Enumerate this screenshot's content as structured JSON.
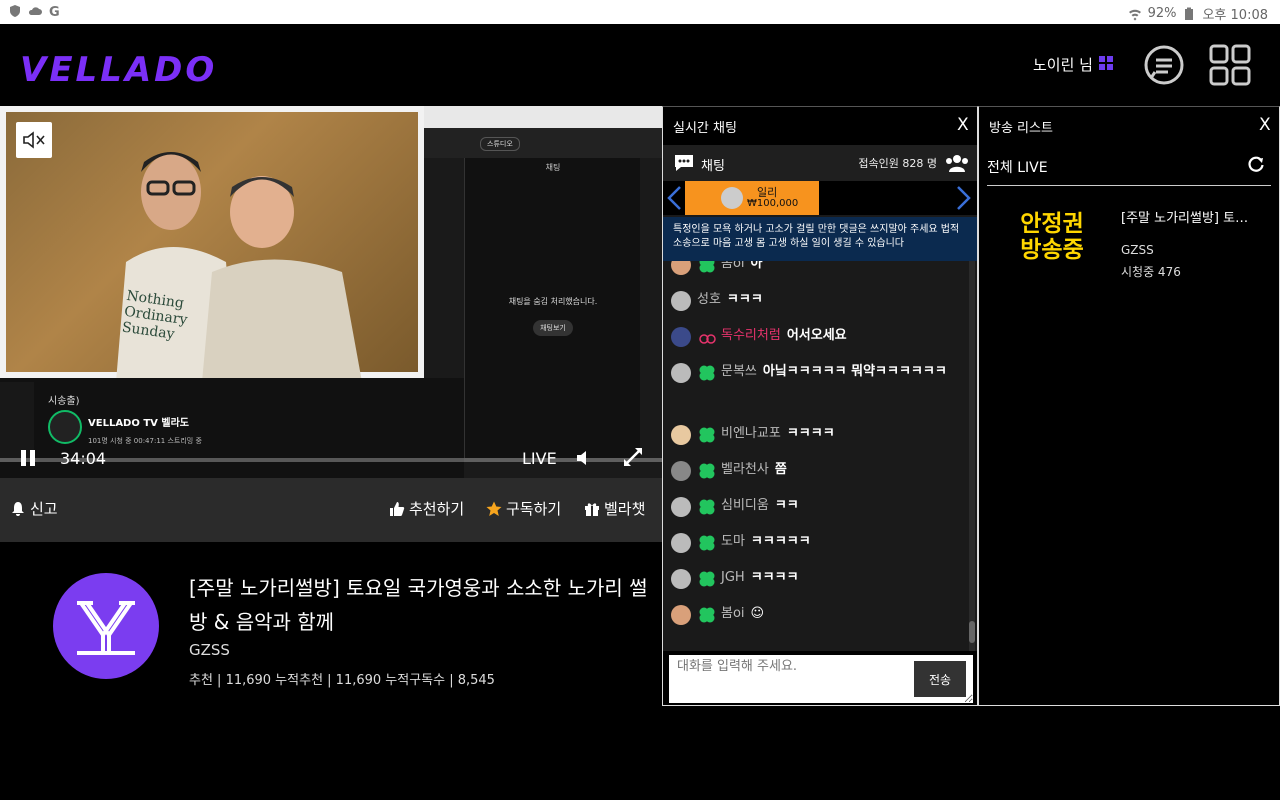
{
  "statusbar": {
    "battery": "92%",
    "time": "오후 10:08"
  },
  "header": {
    "logo": "VELLADO",
    "user_name": "노이린 님"
  },
  "player": {
    "time": "34:04",
    "live_label": "LIVE",
    "inner_chat_title": "채팅",
    "inner_chat_hidden": "채팅을 숨김 처리했습니다.",
    "inner_chat_show": "채팅보기",
    "inner_channel_title": "시송출)",
    "inner_channel_name": "VELLADO TV 벨라도",
    "inner_channel_sub": "101명 시청 중   00:47:11 스트리밍 중",
    "inner_studio": "스튜디오",
    "shirt_text": [
      "Nothing",
      "Ordinary",
      "Sunday"
    ]
  },
  "actions": {
    "report": "신고",
    "recommend": "추천하기",
    "subscribe": "구독하기",
    "gift": "벨라챗"
  },
  "broadcast": {
    "title": "[주말 노가리썰방] 토요일 국가영웅과 소소한 노가리 썰방 & 음악과 함께",
    "channel": "GZSS",
    "stats": "추천 | 11,690   누적추천 | 11,690   누적구독수 | 8,545"
  },
  "chat": {
    "header_title": "실시간 채팅",
    "close": "X",
    "tab_label": "채팅",
    "viewer_count": "접속인원 828 명",
    "donation": {
      "name": "일리",
      "amount": "₩100,000"
    },
    "notice": "특정인을 모욕 하거나 고소가 걸릴 만한 댓글은 쓰지말아 주세요 법적소송으로 마음 고생 몸 고생 하실 일이 생길 수 있습니다",
    "messages": [
      {
        "nick": "봄oi",
        "text": "아"
      },
      {
        "nick": "성호",
        "text": "ㅋㅋㅋ"
      },
      {
        "nick": "독수리처럼",
        "text": "어서오세요"
      },
      {
        "nick": "문복쓰",
        "text": "아닠ㅋㅋㅋㅋㅋ 뭐약ㅋㅋㅋㅋㅋㅋ"
      },
      {
        "nick": "비엔나교포",
        "text": "ㅋㅋㅋㅋ"
      },
      {
        "nick": "벨라천사",
        "text": "쯤"
      },
      {
        "nick": "심비디움",
        "text": "ㅋㅋ"
      },
      {
        "nick": "도마",
        "text": "ㅋㅋㅋㅋㅋ"
      },
      {
        "nick": "JGH",
        "text": "ㅋㅋㅋㅋ"
      },
      {
        "nick": "봄oi",
        "text": "☺"
      }
    ],
    "input_placeholder": "대화를 입력해 주세요.",
    "send": "전송"
  },
  "broadcast_list": {
    "title": "방송 리스트",
    "close": "X",
    "filter": "전체 LIVE",
    "items": [
      {
        "thumb_text": "안정권 방송중",
        "title": "[주말 노가리썰방] 토…",
        "channel": "GZSS",
        "viewers": "시청중 476"
      }
    ]
  },
  "colors": {
    "brand": "#7b2ff7",
    "donation": "#f7931e",
    "notice": "#0b2a4f",
    "badge": "#22c55e"
  }
}
